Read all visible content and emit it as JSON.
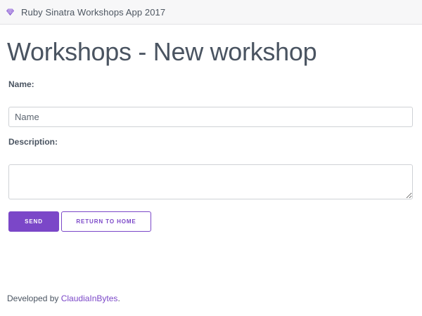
{
  "navbar": {
    "brand_icon": "gem-icon",
    "title": "Ruby Sinatra Workshops App 2017"
  },
  "page": {
    "title": "Workshops - New workshop"
  },
  "form": {
    "name_label": "Name:",
    "name_placeholder": "Name",
    "name_value": "",
    "description_label": "Description:",
    "description_value": "",
    "send_label": "Send",
    "return_label": "Return to home"
  },
  "footer": {
    "prefix": "Developed by ",
    "author_link": "ClaudiaInBytes",
    "suffix": "."
  },
  "colors": {
    "accent": "#7b47c8",
    "navbar_bg": "#f7f7f8",
    "text": "#4a5461"
  }
}
